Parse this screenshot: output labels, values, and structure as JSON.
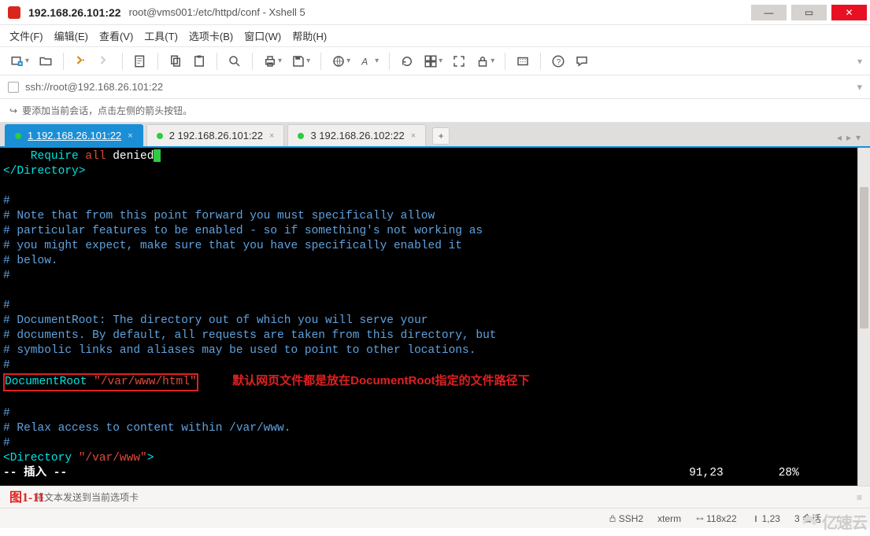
{
  "title": {
    "ip": "192.168.26.101:22",
    "path": "root@vms001:/etc/httpd/conf - Xshell 5"
  },
  "menu": {
    "file": "文件(F)",
    "edit": "编辑(E)",
    "view": "查看(V)",
    "tools": "工具(T)",
    "tabs": "选项卡(B)",
    "window": "窗口(W)",
    "help": "帮助(H)"
  },
  "address": "ssh://root@192.168.26.101:22",
  "hint": "要添加当前会话，点击左侧的箭头按钮。",
  "tabs": {
    "t1": "1 192.168.26.101:22",
    "t2": "2 192.168.26.101:22",
    "t3": "3 192.168.26.102:22"
  },
  "term": {
    "l0a": "    Require ",
    "l0b": "all ",
    "l0c": "denied",
    "l1": "</Directory>",
    "c1": "#",
    "c2": "# Note that from this point forward you must specifically allow",
    "c3": "# particular features to be enabled - so if something's not working as",
    "c4": "# you might expect, make sure that you have specifically enabled it",
    "c5": "# below.",
    "c6": "#",
    "c7": "#",
    "c8": "# DocumentRoot: The directory out of which you will serve your",
    "c9": "# documents. By default, all requests are taken from this directory, but",
    "c10": "# symbolic links and aliases may be used to point to other locations.",
    "c11": "#",
    "dr_key": "DocumentRoot ",
    "dr_val": "\"/var/www/html\"",
    "annotation": "默认网页文件都是放在DocumentRoot指定的文件路径下",
    "c12": "#",
    "c13": "# Relax access to content within /var/www.",
    "c14": "#",
    "dir_open": "<Directory ",
    "dir_val": "\"/var/www\"",
    "dir_close": ">",
    "mode": "-- 插入 --",
    "pos": "91,23",
    "pct": "28%"
  },
  "caption": "图1-11",
  "footer_hint": "将文本发送到当前选项卡",
  "status": {
    "ssh": "SSH2",
    "term": "xterm",
    "size": "118x22",
    "cursor": "1,23",
    "sess": "3 会话"
  },
  "watermark": "亿速云"
}
